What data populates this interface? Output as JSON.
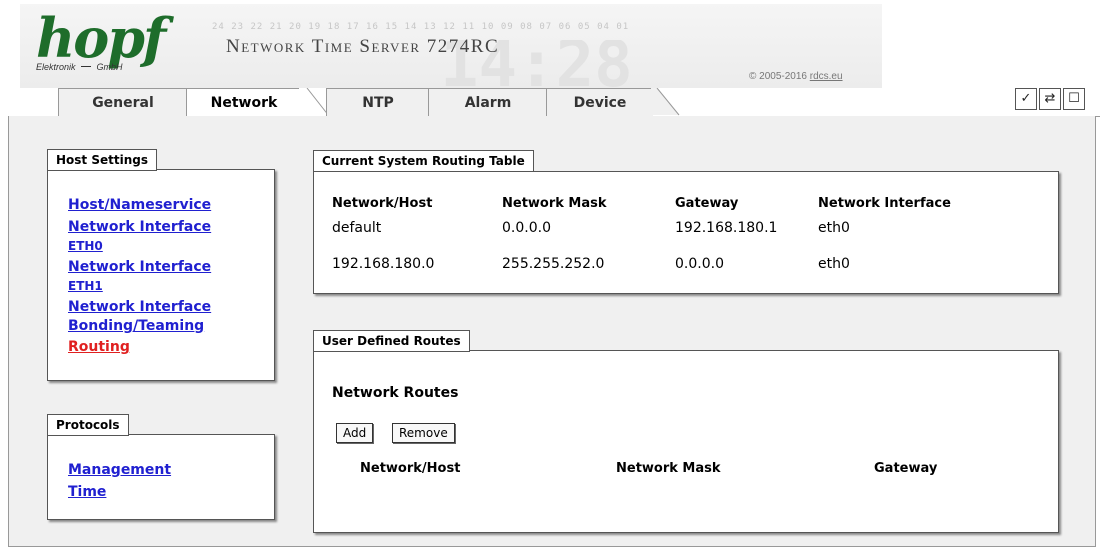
{
  "header": {
    "logo_text": "hopf",
    "logo_sub_left": "Elektronik",
    "logo_sub_right": "GmbH",
    "digit_strip": "24 23 22 21 20 19 18 17 16 15 14 13 12 11 10 09 08 07 06 05 04 01",
    "watermark_time": "14:28",
    "product_title": "Network Time Server 7274RC",
    "copyright_prefix": "© 2005-2016 ",
    "copyright_link": "rdcs.eu"
  },
  "tabs": [
    {
      "label": "General"
    },
    {
      "label": "Network"
    },
    {
      "label": "NTP"
    },
    {
      "label": "Alarm"
    },
    {
      "label": "Device"
    }
  ],
  "toolbar": {
    "apply_icon": "✓",
    "reload_icon": "⇄",
    "page_icon": "☐"
  },
  "host_settings": {
    "title": "Host Settings",
    "links": [
      {
        "line1": "Host/Nameservice",
        "line2": ""
      },
      {
        "line1": "Network Interface",
        "line2": "ETH0"
      },
      {
        "line1": "Network Interface",
        "line2": "ETH1"
      },
      {
        "line1": "Network Interface",
        "line2": "Bonding/Teaming"
      },
      {
        "line1": "Routing",
        "line2": ""
      }
    ]
  },
  "protocols": {
    "title": "Protocols",
    "links": [
      {
        "label": "Management"
      },
      {
        "label": "Time"
      }
    ]
  },
  "routing_table": {
    "title": "Current System Routing Table",
    "headers": [
      "Network/Host",
      "Network Mask",
      "Gateway",
      "Network Interface"
    ],
    "rows": [
      [
        "default",
        "0.0.0.0",
        "192.168.180.1",
        "eth0"
      ],
      [
        "192.168.180.0",
        "255.255.252.0",
        "0.0.0.0",
        "eth0"
      ]
    ]
  },
  "user_routes": {
    "title": "User Defined Routes",
    "section_title": "Network Routes",
    "add_label": "Add",
    "remove_label": "Remove",
    "headers": [
      "Network/Host",
      "Network Mask",
      "Gateway"
    ]
  }
}
